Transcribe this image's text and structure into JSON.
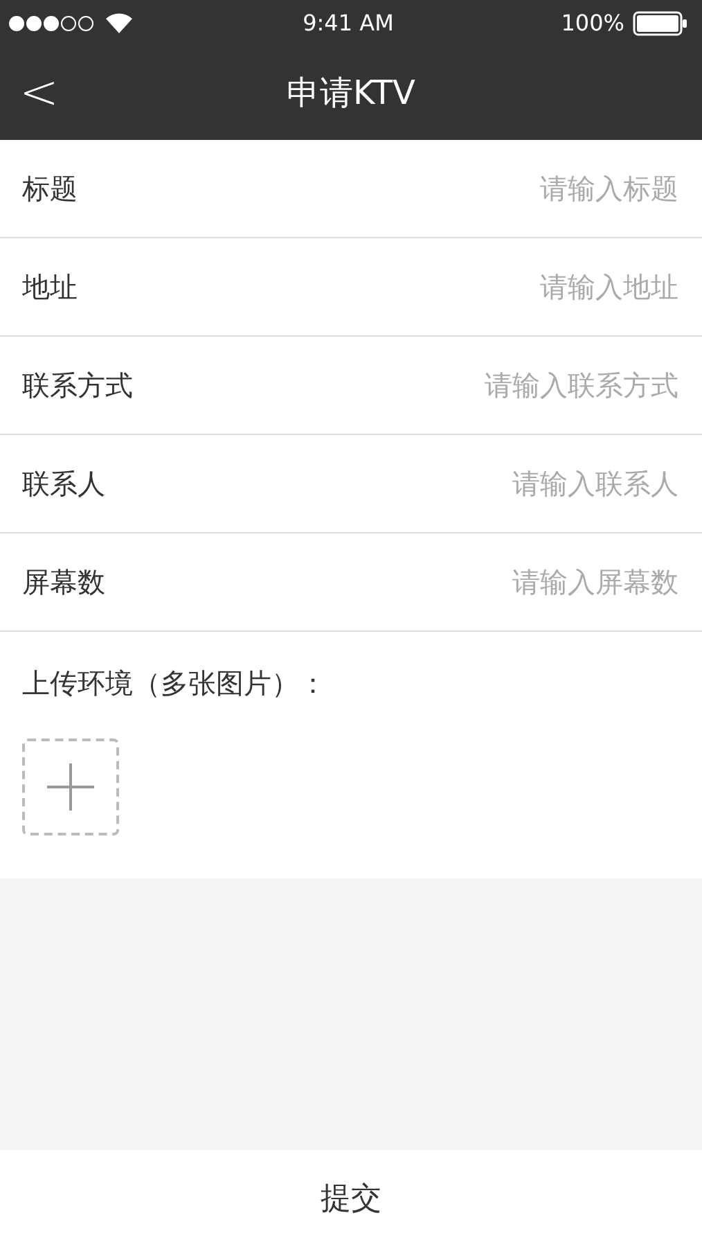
{
  "status_bar": {
    "time": "9:41 AM",
    "battery": "100%"
  },
  "nav": {
    "back": "<",
    "title": "申请KTV"
  },
  "fields": [
    {
      "label": "标题",
      "placeholder": "请输入标题"
    },
    {
      "label": "地址",
      "placeholder": "请输入地址"
    },
    {
      "label": "联系方式",
      "placeholder": "请输入联系方式"
    },
    {
      "label": "联系人",
      "placeholder": "请输入联系人"
    },
    {
      "label": "屏幕数",
      "placeholder": "请输入屏幕数"
    }
  ],
  "upload": {
    "label": "上传环境（多张图片）："
  },
  "submit": "提交"
}
